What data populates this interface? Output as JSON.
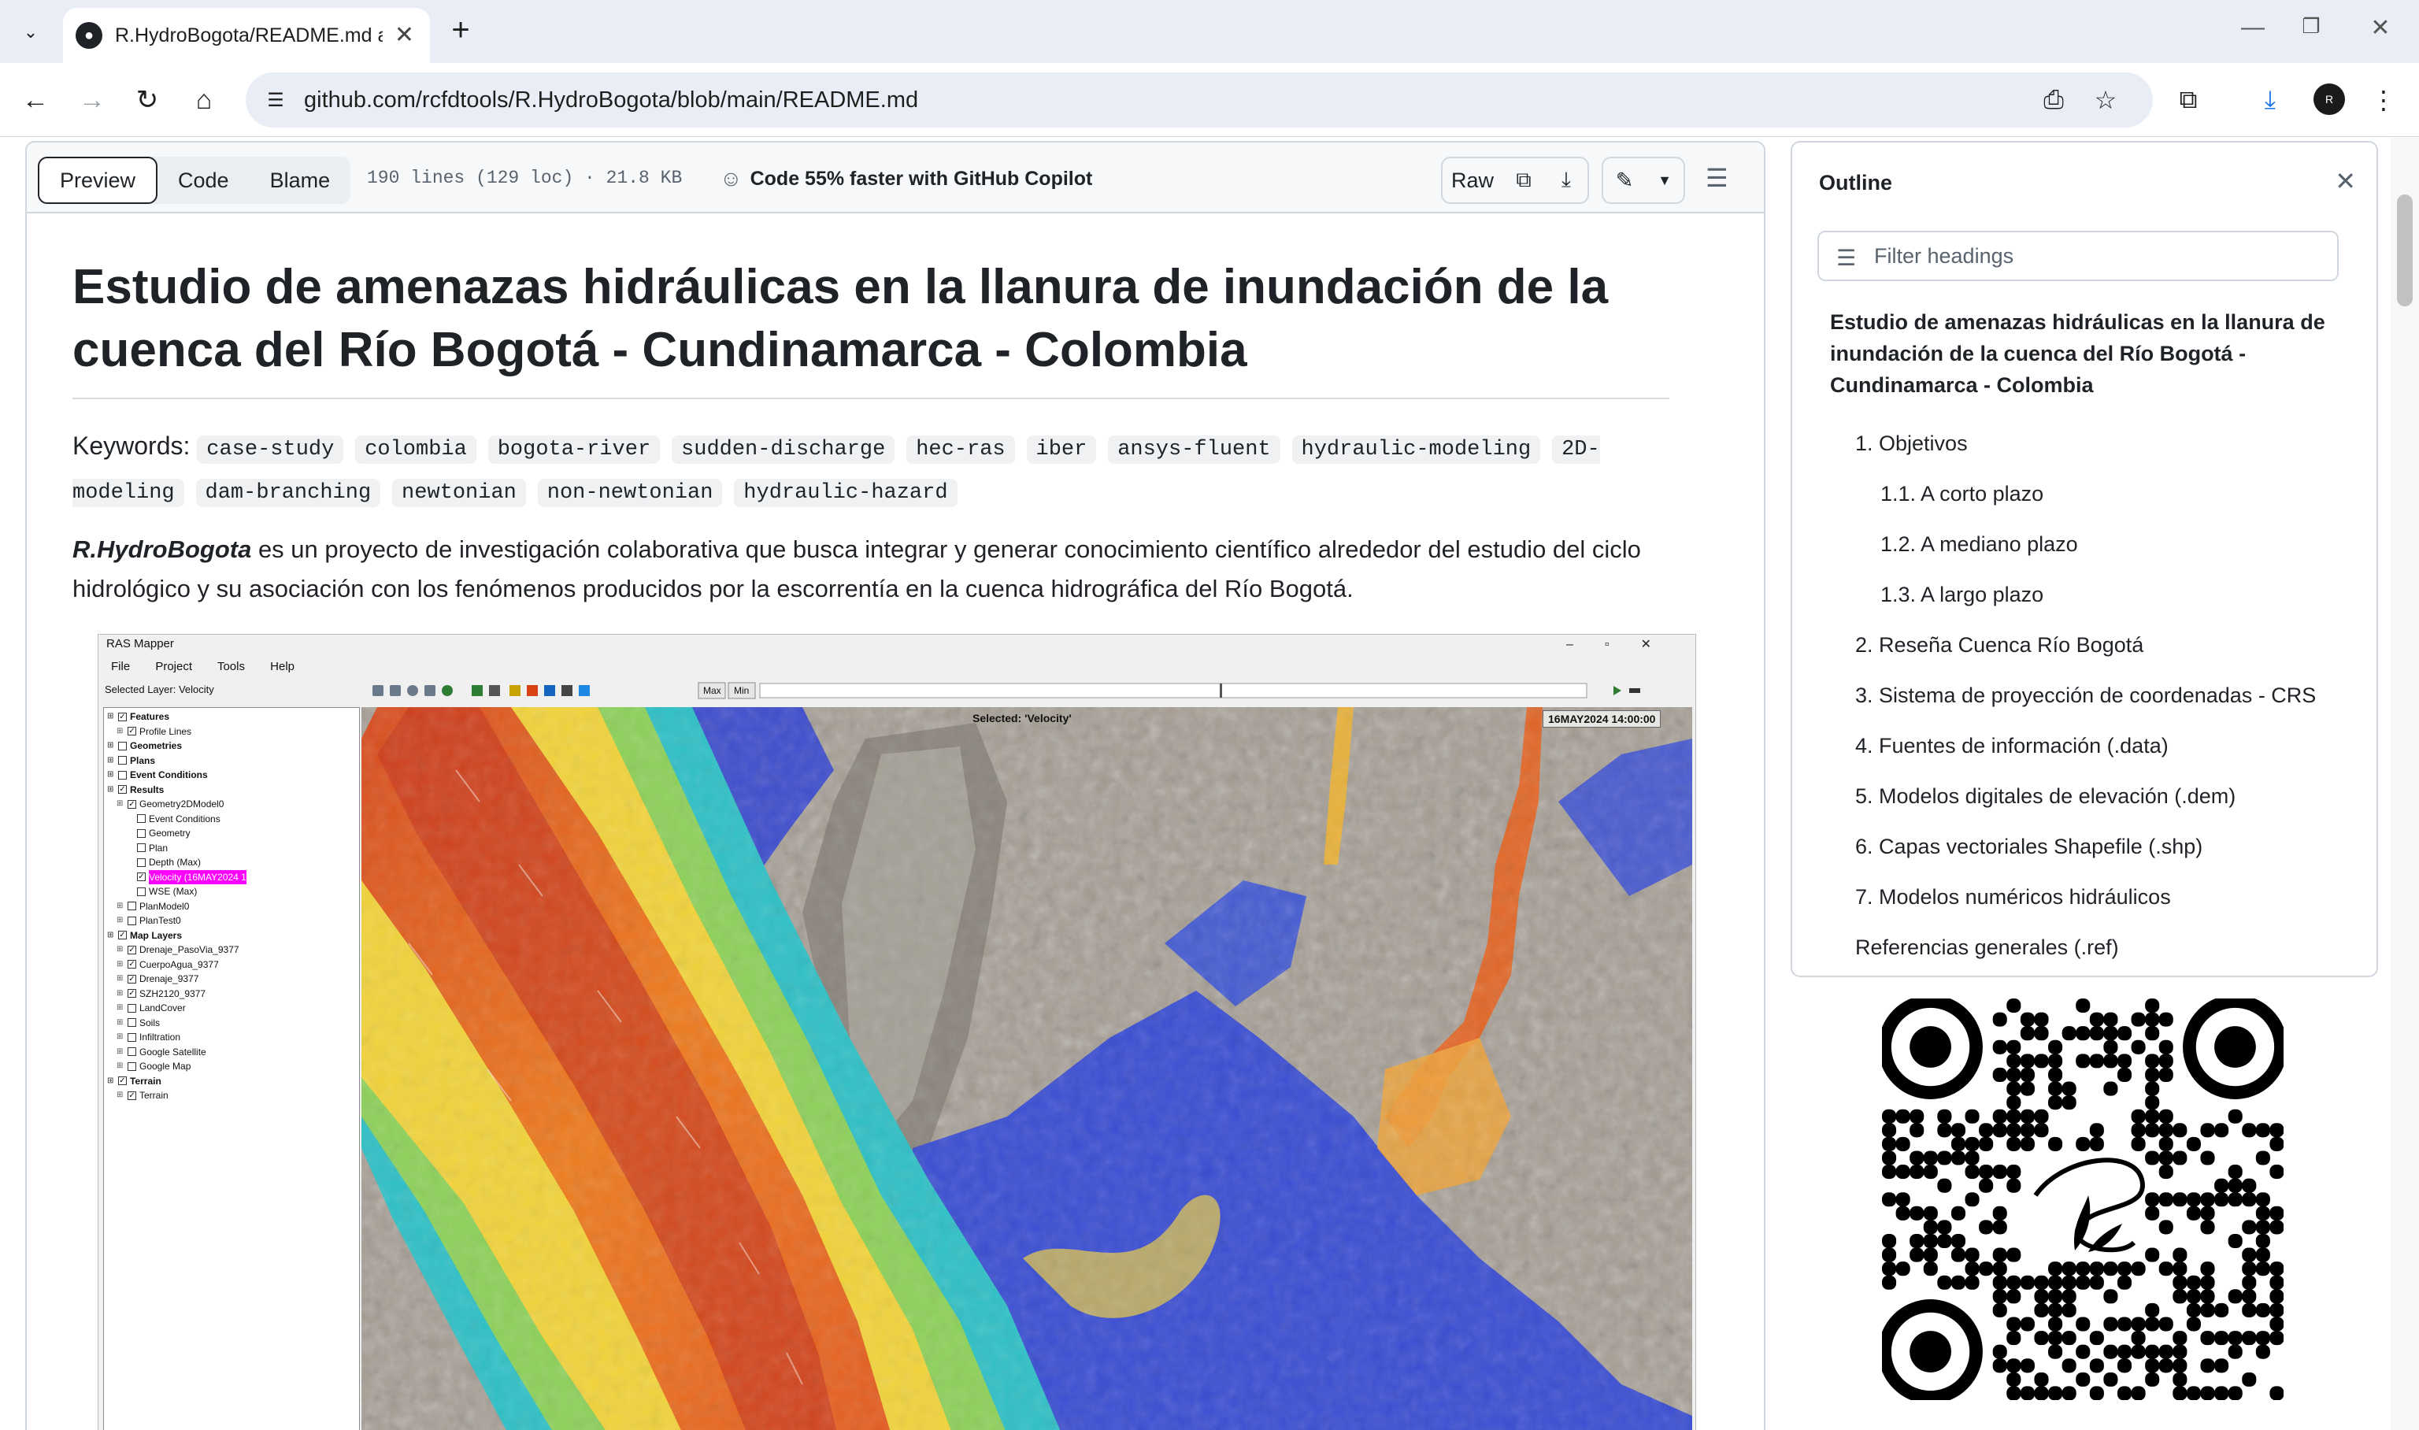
{
  "browser": {
    "tab": {
      "title": "R.HydroBogota/README.md at",
      "favicon": "github-icon"
    },
    "url": "github.com/rcfdtools/R.HydroBogota/blob/main/README.md",
    "profile_initial": "R"
  },
  "file_header": {
    "tabs": [
      {
        "label": "Preview",
        "active": true
      },
      {
        "label": "Code",
        "active": false
      },
      {
        "label": "Blame",
        "active": false
      }
    ],
    "info": "190 lines (129 loc) · 21.8 KB",
    "copilot": "Code 55% faster with GitHub Copilot",
    "raw_label": "Raw"
  },
  "readme": {
    "title": "Estudio de amenazas hidráulicas en la llanura de inundación de la cuenca del Río Bogotá - Cundinamarca - Colombia",
    "keywords_label": "Keywords:",
    "keywords": [
      "case-study",
      "colombia",
      "bogota-river",
      "sudden-discharge",
      "hec-ras",
      "iber",
      "ansys-fluent",
      "hydraulic-modeling",
      "2D-modeling",
      "dam-branching",
      "newtonian",
      "non-newtonian",
      "hydraulic-hazard"
    ],
    "intro_brand": "R.HydroBogota",
    "intro_text": " es un proyecto de investigación colaborativa que busca integrar y generar conocimiento científico alrededor del estudio del ciclo hidrológico y su asociación con los fenómenos producidos por la escorrentía en la cuenca hidrográfica del Río Bogotá."
  },
  "ras_mapper": {
    "title": "RAS Mapper",
    "menu": [
      "File",
      "Project",
      "Tools",
      "Help"
    ],
    "selected_layer": "Selected Layer: Velocity",
    "selected_chip": "Selected: 'Velocity'",
    "time_chip": "16MAY2024 14:00:00",
    "tool_max": "Max",
    "tool_min": "Min",
    "tree": [
      {
        "label": "Features",
        "level": 0,
        "bold": true,
        "checked": true
      },
      {
        "label": "Profile Lines",
        "level": 1,
        "checked": true
      },
      {
        "label": "Geometries",
        "level": 0,
        "bold": true,
        "checked": false
      },
      {
        "label": "Plans",
        "level": 0,
        "bold": true,
        "checked": false
      },
      {
        "label": "Event Conditions",
        "level": 0,
        "bold": true,
        "checked": false
      },
      {
        "label": "Results",
        "level": 0,
        "bold": true,
        "checked": true
      },
      {
        "label": "Geometry2DModel0",
        "level": 1,
        "checked": true
      },
      {
        "label": "Event Conditions",
        "level": 2,
        "checked": false
      },
      {
        "label": "Geometry",
        "level": 2,
        "checked": false
      },
      {
        "label": "Plan",
        "level": 2,
        "checked": false
      },
      {
        "label": "Depth (Max)",
        "level": 2,
        "checked": false
      },
      {
        "label": "Velocity (16MAY2024 1",
        "level": 2,
        "checked": true,
        "highlight": true
      },
      {
        "label": "WSE (Max)",
        "level": 2,
        "checked": false
      },
      {
        "label": "PlanModel0",
        "level": 1,
        "checked": false
      },
      {
        "label": "PlanTest0",
        "level": 1,
        "checked": false
      },
      {
        "label": "Map Layers",
        "level": 0,
        "bold": true,
        "checked": true
      },
      {
        "label": "Drenaje_PasoVia_9377",
        "level": 1,
        "checked": true
      },
      {
        "label": "CuerpoAgua_9377",
        "level": 1,
        "checked": true
      },
      {
        "label": "Drenaje_9377",
        "level": 1,
        "checked": true
      },
      {
        "label": "SZH2120_9377",
        "level": 1,
        "checked": true
      },
      {
        "label": "LandCover",
        "level": 1,
        "checked": false
      },
      {
        "label": "Soils",
        "level": 1,
        "checked": false
      },
      {
        "label": "Infiltration",
        "level": 1,
        "checked": false
      },
      {
        "label": "Google Satellite",
        "level": 1,
        "checked": false
      },
      {
        "label": "Google Map",
        "level": 1,
        "checked": false
      },
      {
        "label": "Terrain",
        "level": 0,
        "bold": true,
        "checked": true
      },
      {
        "label": "Terrain",
        "level": 1,
        "checked": true
      }
    ]
  },
  "outline": {
    "title": "Outline",
    "filter_placeholder": "Filter headings",
    "items": [
      {
        "label": "Estudio de amenazas hidráulicas en la llanura de inundación de la cuenca del Río Bogotá - Cundinamarca - Colombia",
        "level": 1
      },
      {
        "label": "1. Objetivos",
        "level": 2
      },
      {
        "label": "1.1. A corto plazo",
        "level": 3
      },
      {
        "label": "1.2. A mediano plazo",
        "level": 3
      },
      {
        "label": "1.3. A largo plazo",
        "level": 3
      },
      {
        "label": "2. Reseña Cuenca Río Bogotá",
        "level": 2
      },
      {
        "label": "3. Sistema de proyección de coordenadas - CRS",
        "level": 2
      },
      {
        "label": "4. Fuentes de información (.data)",
        "level": 2
      },
      {
        "label": "5. Modelos digitales de elevación (.dem)",
        "level": 2
      },
      {
        "label": "6. Capas vectoriales Shapefile (.shp)",
        "level": 2
      },
      {
        "label": "7. Modelos numéricos hidráulicos",
        "level": 2
      },
      {
        "label": "Referencias generales (.ref)",
        "level": 2
      }
    ]
  }
}
